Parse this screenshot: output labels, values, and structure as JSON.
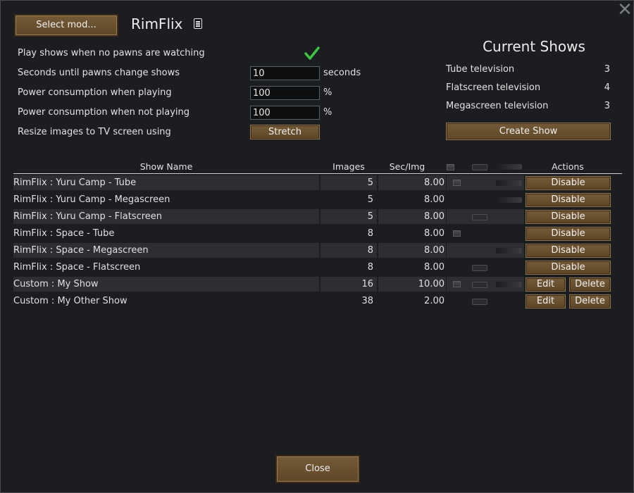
{
  "top": {
    "select_mod_label": "Select mod...",
    "title": "RimFlix"
  },
  "settings": {
    "play_no_pawns_label": "Play shows when no pawns are watching",
    "seconds_label": "Seconds until pawns change shows",
    "seconds_value": "10",
    "seconds_unit": "seconds",
    "power_playing_label": "Power consumption when playing",
    "power_playing_value": "100",
    "power_playing_unit": "%",
    "power_idle_label": "Power consumption when not playing",
    "power_idle_value": "100",
    "power_idle_unit": "%",
    "resize_label": "Resize images to TV screen using",
    "resize_value": "Stretch",
    "check_color": "#3fc43f"
  },
  "current_shows": {
    "title": "Current Shows",
    "items": [
      {
        "label": "Tube television",
        "count": "3"
      },
      {
        "label": "Flatscreen television",
        "count": "4"
      },
      {
        "label": "Megascreen television",
        "count": "3"
      }
    ],
    "create_label": "Create Show"
  },
  "table": {
    "headers": {
      "name": "Show Name",
      "images": "Images",
      "sec": "Sec/Img",
      "actions": "Actions"
    },
    "rows": [
      {
        "name": "RimFlix : Yuru Camp - Tube",
        "images": "5",
        "sec": "8.00",
        "btn1": "Disable"
      },
      {
        "name": "RimFlix : Yuru Camp - Megascreen",
        "images": "5",
        "sec": "8.00",
        "btn1": "Disable"
      },
      {
        "name": "RimFlix : Yuru Camp - Flatscreen",
        "images": "5",
        "sec": "8.00",
        "btn1": "Disable"
      },
      {
        "name": "RimFlix : Space - Tube",
        "images": "8",
        "sec": "8.00",
        "btn1": "Disable"
      },
      {
        "name": "RimFlix : Space - Megascreen",
        "images": "8",
        "sec": "8.00",
        "btn1": "Disable"
      },
      {
        "name": "RimFlix : Space - Flatscreen",
        "images": "8",
        "sec": "8.00",
        "btn1": "Disable"
      },
      {
        "name": "Custom : My Show",
        "images": "16",
        "sec": "10.00",
        "btn1": "Edit",
        "btn2": "Delete"
      },
      {
        "name": "Custom : My Other Show",
        "images": "38",
        "sec": "2.00",
        "btn1": "Edit",
        "btn2": "Delete"
      }
    ]
  },
  "footer": {
    "close_label": "Close"
  }
}
